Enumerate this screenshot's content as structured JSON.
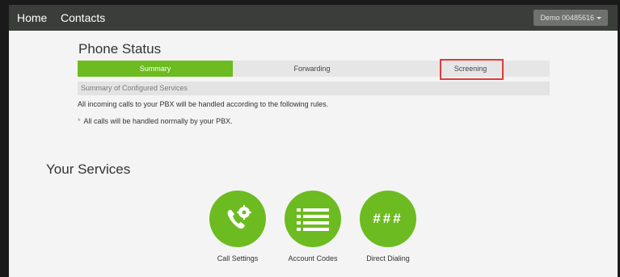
{
  "nav": {
    "home": "Home",
    "contacts": "Contacts",
    "account": "Demo 00485616"
  },
  "phone_status": {
    "title": "Phone Status",
    "tabs": [
      {
        "label": "Summary",
        "active": true
      },
      {
        "label": "Forwarding",
        "active": false
      },
      {
        "label": "Screening",
        "active": false
      }
    ],
    "section_header": "Summary of Configured Services",
    "rules_text": "All incoming calls to your PBX will be handled according to the following rules.",
    "bullet_marker": "*",
    "bullet_text": "All calls will be handled normally by your PBX."
  },
  "services": {
    "title": "Your Services",
    "items": [
      {
        "label": "Call Settings",
        "icon": "phone-gear-icon"
      },
      {
        "label": "Account Codes",
        "icon": "list-icon"
      },
      {
        "label": "Direct Dialing",
        "icon": "hash-icon",
        "glyphs": "###"
      }
    ]
  },
  "colors": {
    "accent": "#6cbb20",
    "navbar": "#3b3d3b",
    "highlight": "#e23b3b",
    "background": "#f4f4f4"
  }
}
